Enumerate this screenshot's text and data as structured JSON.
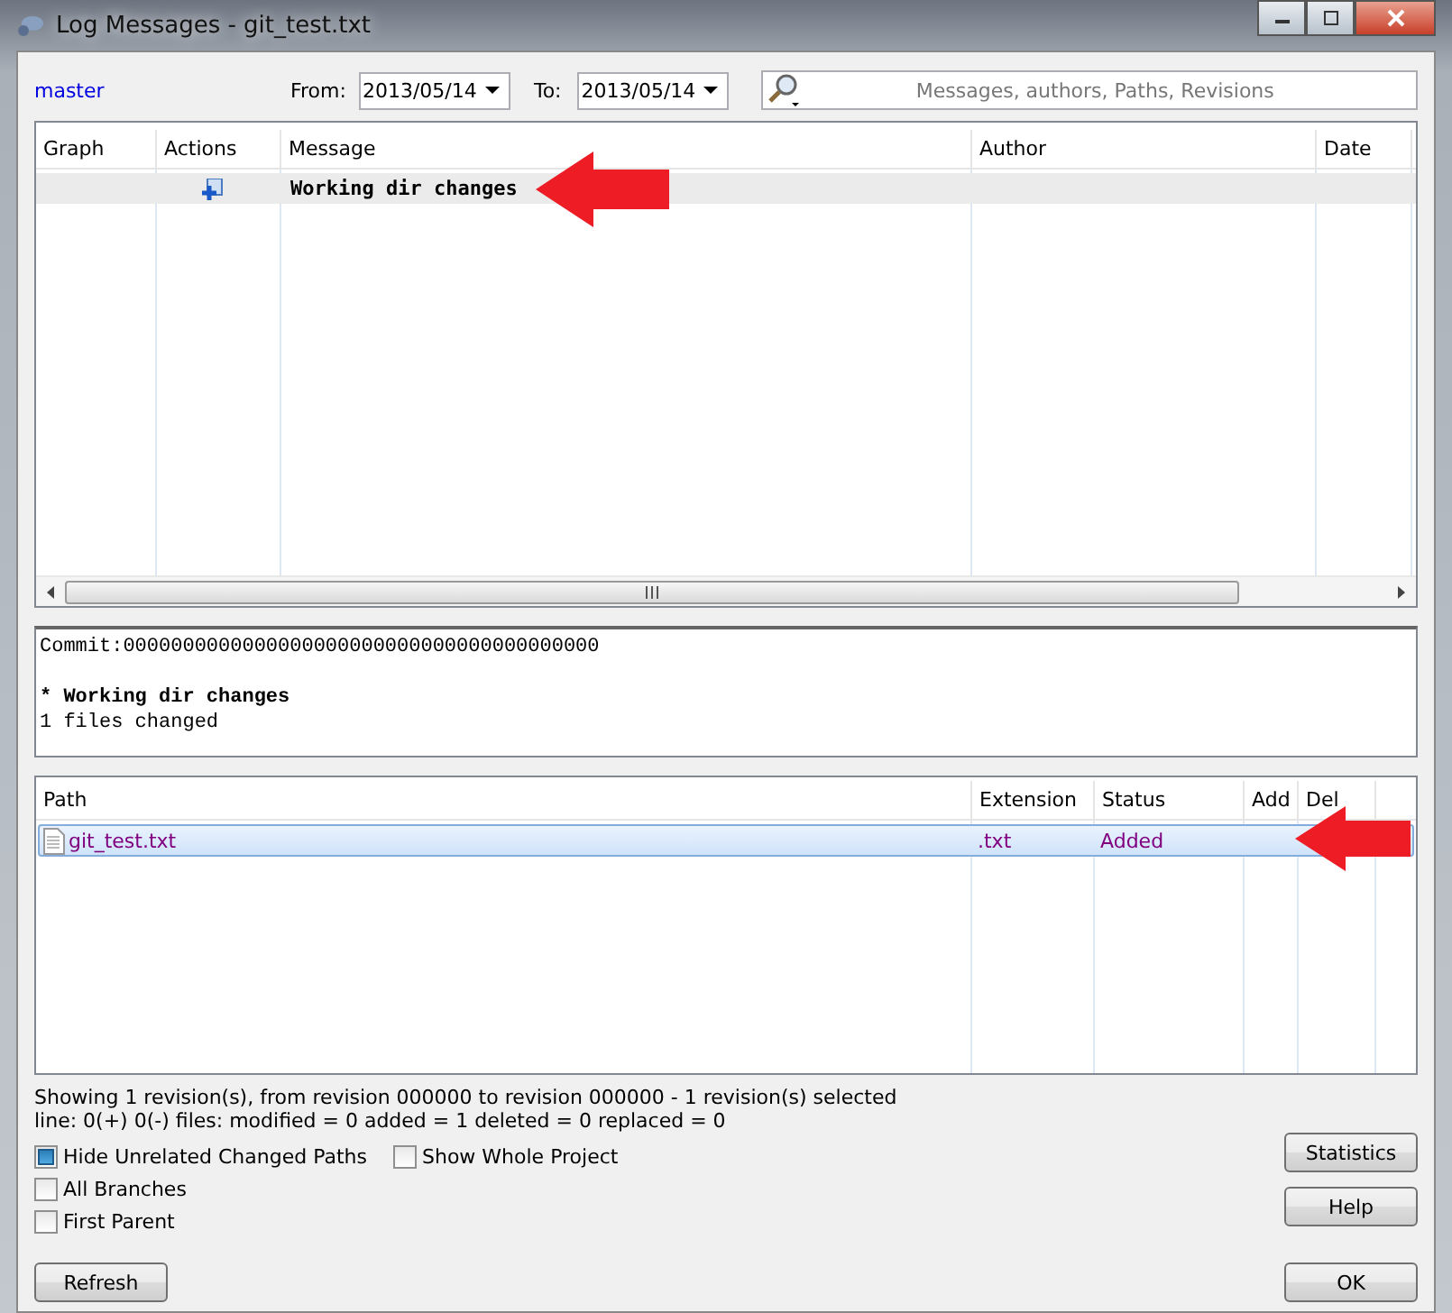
{
  "window": {
    "title": "Log Messages - git_test.txt"
  },
  "toolbar": {
    "branch": "master",
    "from_label": "From:",
    "from_date": "2013/05/14",
    "to_label": "To:",
    "to_date": "2013/05/14",
    "search_placeholder": "Messages, authors, Paths, Revisions"
  },
  "revisions": {
    "columns": [
      "Graph",
      "Actions",
      "Message",
      "Author",
      "Date"
    ],
    "rows": [
      {
        "message": "Working dir changes",
        "selected": true
      }
    ]
  },
  "commit_text": [
    "Commit:0000000000000000000000000000000000000000",
    "* Working dir changes",
    "1 files changed"
  ],
  "files": {
    "columns": [
      "Path",
      "Extension",
      "Status",
      "Add",
      "Del"
    ],
    "rows": [
      {
        "path": "git_test.txt",
        "extension": ".txt",
        "status": "Added",
        "selected": true
      }
    ]
  },
  "status_lines": [
    "Showing 1 revision(s), from revision 000000 to revision 000000 - 1 revision(s) selected",
    "line: 0(+) 0(-) files: modified = 0 added = 1 deleted = 0 replaced = 0"
  ],
  "options": [
    {
      "label": "Hide Unrelated Changed Paths",
      "checked": true
    },
    {
      "label": "Show Whole Project",
      "checked": false
    },
    {
      "label": "All Branches",
      "checked": false
    },
    {
      "label": "First Parent",
      "checked": false
    }
  ],
  "buttons": {
    "statistics": "Statistics",
    "help": "Help",
    "refresh": "Refresh",
    "ok": "OK"
  }
}
